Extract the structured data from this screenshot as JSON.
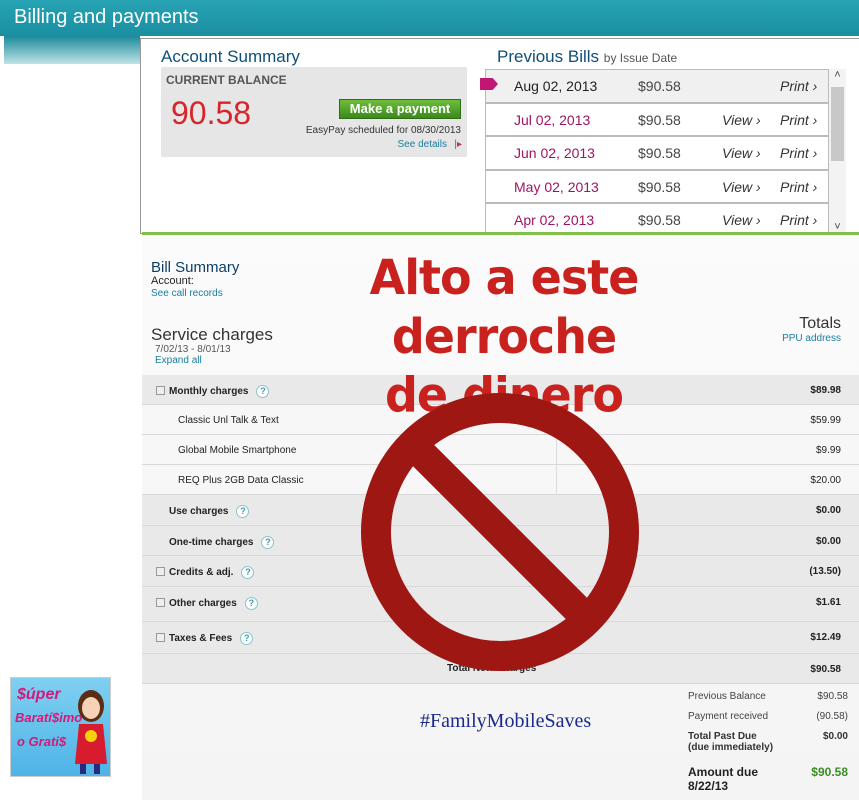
{
  "header": {
    "title": "Billing and payments"
  },
  "account_summary": {
    "title": "Account Summary",
    "balance_label": "CURRENT BALANCE",
    "balance": "90.58",
    "pay_button": "Make a payment",
    "easypay": "EasyPay scheduled for 08/30/2013",
    "details_link": "See details"
  },
  "previous_bills": {
    "title": "Previous Bills",
    "subtitle": "by Issue Date",
    "rows": [
      {
        "date": "Aug 02, 2013",
        "amount": "$90.58",
        "view": "",
        "print": "Print ›"
      },
      {
        "date": "Jul 02, 2013",
        "amount": "$90.58",
        "view": "View ›",
        "print": "Print ›"
      },
      {
        "date": "Jun 02, 2013",
        "amount": "$90.58",
        "view": "View ›",
        "print": "Print ›"
      },
      {
        "date": "May 02, 2013",
        "amount": "$90.58",
        "view": "View ›",
        "print": "Print ›"
      },
      {
        "date": "Apr 02, 2013",
        "amount": "$90.58",
        "view": "View ›",
        "print": "Print ›"
      }
    ]
  },
  "bill_summary": {
    "title": "Bill Summary",
    "account_label": "Account:",
    "see_calls": "See call records",
    "service_charges": "Service charges",
    "date_range": "7/02/13 - 8/01/13",
    "expand_all": "Expand all",
    "totals": "Totals",
    "ppu": "PPU address"
  },
  "charges": [
    {
      "label": "Monthly charges",
      "value": "$89.98"
    },
    {
      "label": "Classic Unl Talk & Text",
      "value": "$59.99"
    },
    {
      "label": "Global Mobile Smartphone",
      "value": "$9.99"
    },
    {
      "label": "REQ Plus 2GB Data Classic",
      "value": "$20.00"
    },
    {
      "label": "Use charges",
      "value": "$0.00"
    },
    {
      "label": "One-time charges",
      "value": "$0.00"
    },
    {
      "label": "Credits & adj.",
      "value": "(13.50)"
    },
    {
      "label": "Other charges",
      "value": "$1.61"
    },
    {
      "label": "Taxes & Fees",
      "value": "$12.49"
    },
    {
      "label": "Total New Charges",
      "value": "$90.58"
    }
  ],
  "summary": {
    "previous_balance_label": "Previous Balance",
    "previous_balance": "$90.58",
    "payment_received_label": "Payment received",
    "payment_received": "(90.58)",
    "total_past_due_label": "Total Past Due",
    "total_past_due_sub": "(due immediately)",
    "total_past_due": "$0.00",
    "amount_due_label": "Amount due",
    "amount_due_date": "8/22/13",
    "amount_due": "$90.58"
  },
  "overlay": {
    "line1": "Alto a este derroche",
    "line2": "de dinero",
    "hashtag": "#FamilyMobileSaves",
    "icon": "prohibited-icon",
    "color": "#c8211e"
  },
  "logo": {
    "line1": "$úper",
    "line2": "Baratí$imo",
    "line3": "o Grati$"
  }
}
